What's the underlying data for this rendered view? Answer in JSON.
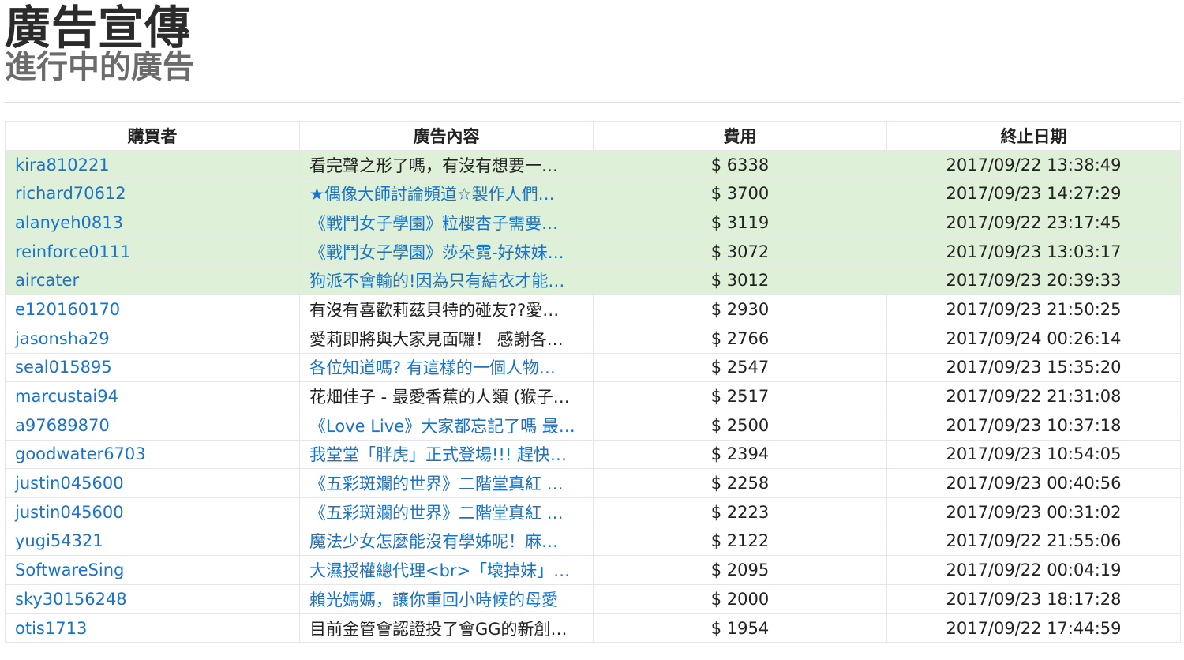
{
  "header": {
    "title": "廣告宣傳",
    "subtitle": "進行中的廣告"
  },
  "colors": {
    "link": "#1a73c8",
    "featured_row_bg": "#dff0d8"
  },
  "table": {
    "columns": [
      "購買者",
      "廣告內容",
      "費用",
      "終止日期"
    ],
    "rows": [
      {
        "buyer": "kira810221",
        "content": "看完聲之形了嗎，有沒有想要一…",
        "content_is_link": false,
        "cost": "$ 6338",
        "end_date": "2017/09/22 13:38:49",
        "featured": true
      },
      {
        "buyer": "richard70612",
        "content": "★偶像大師討論頻道☆製作人們…",
        "content_is_link": true,
        "cost": "$ 3700",
        "end_date": "2017/09/23 14:27:29",
        "featured": true
      },
      {
        "buyer": "alanyeh0813",
        "content": "《戰鬥女子學園》粒櫻杏子需要…",
        "content_is_link": true,
        "cost": "$ 3119",
        "end_date": "2017/09/22 23:17:45",
        "featured": true
      },
      {
        "buyer": "reinforce0111",
        "content": "《戰鬥女子學園》莎朵霓-好妹妹…",
        "content_is_link": true,
        "cost": "$ 3072",
        "end_date": "2017/09/23 13:03:17",
        "featured": true
      },
      {
        "buyer": "aircater",
        "content": "狗派不會輸的!因為只有結衣才能…",
        "content_is_link": true,
        "cost": "$ 3012",
        "end_date": "2017/09/23 20:39:33",
        "featured": true
      },
      {
        "buyer": "e120160170",
        "content": "有沒有喜歡莉茲貝特的碰友??愛…",
        "content_is_link": false,
        "cost": "$ 2930",
        "end_date": "2017/09/23 21:50:25",
        "featured": false
      },
      {
        "buyer": "jasonsha29",
        "content": "愛莉即將與大家見面囉！ 感謝各…",
        "content_is_link": false,
        "cost": "$ 2766",
        "end_date": "2017/09/24 00:26:14",
        "featured": false
      },
      {
        "buyer": "seal015895",
        "content": "各位知道嗎? 有這樣的一個人物…",
        "content_is_link": true,
        "cost": "$ 2547",
        "end_date": "2017/09/23 15:35:20",
        "featured": false
      },
      {
        "buyer": "marcustai94",
        "content": "花畑佳子 - 最愛香蕉的人類 (猴子…",
        "content_is_link": false,
        "cost": "$ 2517",
        "end_date": "2017/09/22 21:31:08",
        "featured": false
      },
      {
        "buyer": "a97689870",
        "content": "《Love Live》大家都忘記了嗎 最…",
        "content_is_link": true,
        "cost": "$ 2500",
        "end_date": "2017/09/23 10:37:18",
        "featured": false
      },
      {
        "buyer": "goodwater6703",
        "content": "我堂堂「胖虎」正式登場!!! 趕快…",
        "content_is_link": true,
        "cost": "$ 2394",
        "end_date": "2017/09/23 10:54:05",
        "featured": false
      },
      {
        "buyer": "justin045600",
        "content": "《五彩斑斕的世界》二階堂真紅 …",
        "content_is_link": true,
        "cost": "$ 2258",
        "end_date": "2017/09/23 00:40:56",
        "featured": false
      },
      {
        "buyer": "justin045600",
        "content": "《五彩斑斕的世界》二階堂真紅 …",
        "content_is_link": true,
        "cost": "$ 2223",
        "end_date": "2017/09/23 00:31:02",
        "featured": false
      },
      {
        "buyer": "yugi54321",
        "content": "魔法少女怎麼能沒有學姊呢！麻…",
        "content_is_link": true,
        "cost": "$ 2122",
        "end_date": "2017/09/22 21:55:06",
        "featured": false
      },
      {
        "buyer": "SoftwareSing",
        "content": "大濕授權總代理<br>「壞掉妹」…",
        "content_is_link": true,
        "cost": "$ 2095",
        "end_date": "2017/09/22 00:04:19",
        "featured": false
      },
      {
        "buyer": "sky30156248",
        "content": "賴光媽媽，讓你重回小時候的母愛",
        "content_is_link": true,
        "cost": "$ 2000",
        "end_date": "2017/09/23 18:17:28",
        "featured": false
      },
      {
        "buyer": "otis1713",
        "content": "目前金管會認證投了會GG的新創…",
        "content_is_link": false,
        "cost": "$ 1954",
        "end_date": "2017/09/22 17:44:59",
        "featured": false
      }
    ]
  }
}
